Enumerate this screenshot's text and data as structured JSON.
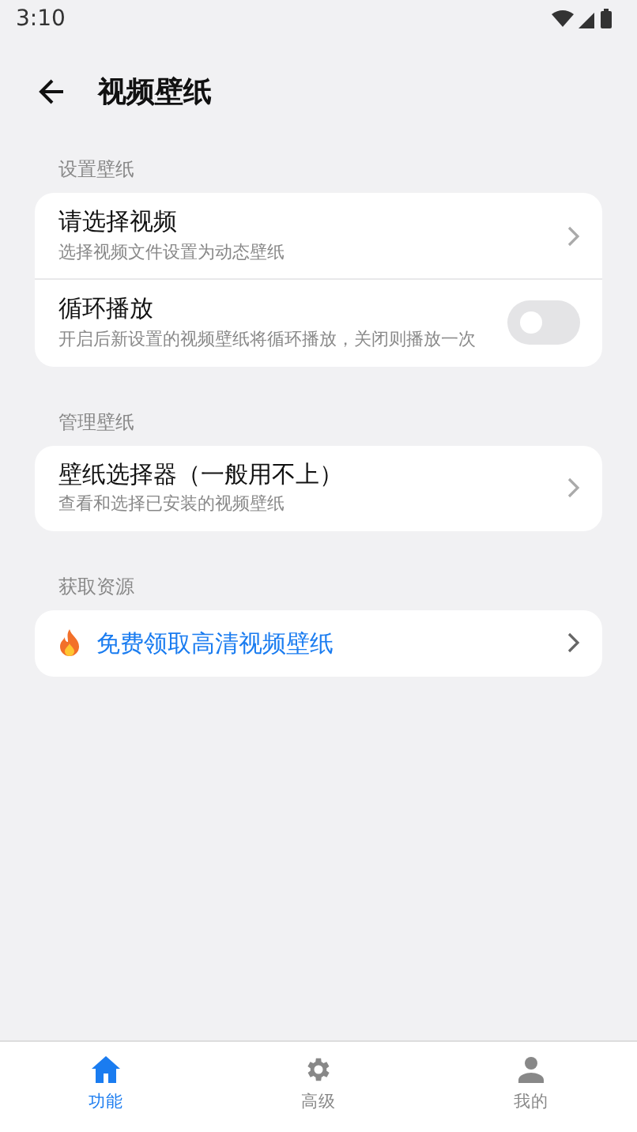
{
  "status_bar": {
    "time": "3:10"
  },
  "header": {
    "title": "视频壁纸"
  },
  "sections": [
    {
      "label": "设置壁纸",
      "rows": [
        {
          "kind": "link",
          "title": "请选择视频",
          "subtitle": "选择视频文件设置为动态壁纸"
        },
        {
          "kind": "toggle",
          "title": "循环播放",
          "subtitle": "开启后新设置的视频壁纸将循环播放，关闭则播放一次",
          "on": false
        }
      ]
    },
    {
      "label": "管理壁纸",
      "rows": [
        {
          "kind": "link",
          "title": "壁纸选择器（一般用不上）",
          "subtitle": "查看和选择已安装的视频壁纸"
        }
      ]
    },
    {
      "label": "获取资源",
      "rows": [
        {
          "kind": "promo",
          "title": "免费领取高清视频壁纸"
        }
      ]
    }
  ],
  "bottom_nav": [
    {
      "kind": "home",
      "label": "功能",
      "selected": true
    },
    {
      "kind": "gear",
      "label": "高级",
      "selected": false
    },
    {
      "kind": "person",
      "label": "我的",
      "selected": false
    }
  ]
}
